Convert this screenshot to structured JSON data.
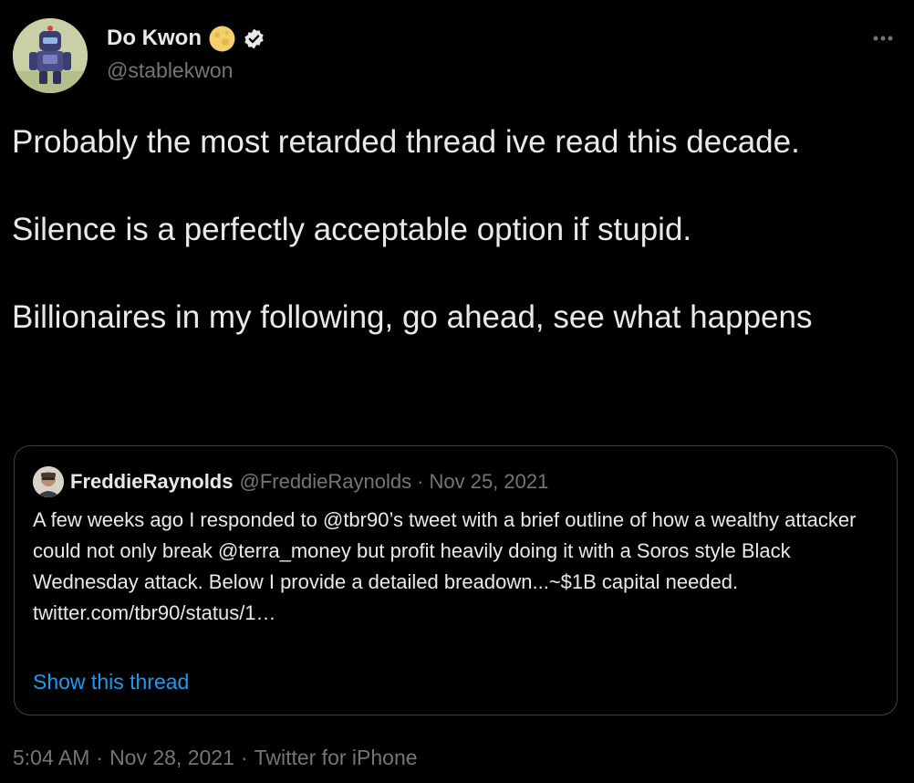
{
  "colors": {
    "background": "#000000",
    "primary_text": "#e7e9ea",
    "secondary_text": "#71767b",
    "link": "#1d9bf0",
    "card_border": "#3e4144"
  },
  "author": {
    "name": "Do Kwon",
    "handle": "@stablekwon",
    "emoji_icon": "full-moon-icon",
    "verified_icon": "verified-badge-icon",
    "avatar_icon": "robot-avatar"
  },
  "menu": {
    "icon": "more-options-icon"
  },
  "tweet": {
    "lines": [
      "Probably the most retarded thread ive read this decade.",
      "Silence is a perfectly acceptable option if stupid.",
      "Billionaires in my following, go ahead, see what happens"
    ]
  },
  "quote": {
    "name": "FreddieRaynolds",
    "handle": "@FreddieRaynolds",
    "separator": "·",
    "date": "Nov 25, 2021",
    "text": "A few weeks ago I responded to @tbr90’s tweet with a brief outline of how a wealthy attacker could not only break @terra_money but profit heavily doing it with a Soros style Black Wednesday attack. Below I provide a detailed breadown...~$1B capital needed.",
    "link": "twitter.com/tbr90/status/1…",
    "show_thread": "Show this thread"
  },
  "meta": {
    "time": "5:04 AM",
    "separator": "·",
    "date": "Nov 28, 2021",
    "source": "Twitter for iPhone"
  }
}
